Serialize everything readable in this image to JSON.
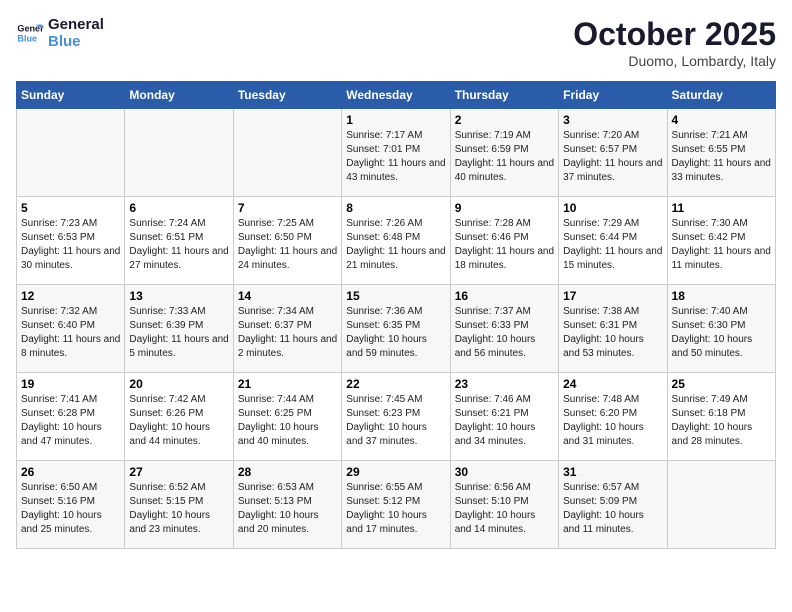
{
  "logo": {
    "line1": "General",
    "line2": "Blue"
  },
  "title": "October 2025",
  "subtitle": "Duomo, Lombardy, Italy",
  "weekdays": [
    "Sunday",
    "Monday",
    "Tuesday",
    "Wednesday",
    "Thursday",
    "Friday",
    "Saturday"
  ],
  "weeks": [
    [
      {
        "day": "",
        "sunrise": "",
        "sunset": "",
        "daylight": ""
      },
      {
        "day": "",
        "sunrise": "",
        "sunset": "",
        "daylight": ""
      },
      {
        "day": "",
        "sunrise": "",
        "sunset": "",
        "daylight": ""
      },
      {
        "day": "1",
        "sunrise": "Sunrise: 7:17 AM",
        "sunset": "Sunset: 7:01 PM",
        "daylight": "Daylight: 11 hours and 43 minutes."
      },
      {
        "day": "2",
        "sunrise": "Sunrise: 7:19 AM",
        "sunset": "Sunset: 6:59 PM",
        "daylight": "Daylight: 11 hours and 40 minutes."
      },
      {
        "day": "3",
        "sunrise": "Sunrise: 7:20 AM",
        "sunset": "Sunset: 6:57 PM",
        "daylight": "Daylight: 11 hours and 37 minutes."
      },
      {
        "day": "4",
        "sunrise": "Sunrise: 7:21 AM",
        "sunset": "Sunset: 6:55 PM",
        "daylight": "Daylight: 11 hours and 33 minutes."
      }
    ],
    [
      {
        "day": "5",
        "sunrise": "Sunrise: 7:23 AM",
        "sunset": "Sunset: 6:53 PM",
        "daylight": "Daylight: 11 hours and 30 minutes."
      },
      {
        "day": "6",
        "sunrise": "Sunrise: 7:24 AM",
        "sunset": "Sunset: 6:51 PM",
        "daylight": "Daylight: 11 hours and 27 minutes."
      },
      {
        "day": "7",
        "sunrise": "Sunrise: 7:25 AM",
        "sunset": "Sunset: 6:50 PM",
        "daylight": "Daylight: 11 hours and 24 minutes."
      },
      {
        "day": "8",
        "sunrise": "Sunrise: 7:26 AM",
        "sunset": "Sunset: 6:48 PM",
        "daylight": "Daylight: 11 hours and 21 minutes."
      },
      {
        "day": "9",
        "sunrise": "Sunrise: 7:28 AM",
        "sunset": "Sunset: 6:46 PM",
        "daylight": "Daylight: 11 hours and 18 minutes."
      },
      {
        "day": "10",
        "sunrise": "Sunrise: 7:29 AM",
        "sunset": "Sunset: 6:44 PM",
        "daylight": "Daylight: 11 hours and 15 minutes."
      },
      {
        "day": "11",
        "sunrise": "Sunrise: 7:30 AM",
        "sunset": "Sunset: 6:42 PM",
        "daylight": "Daylight: 11 hours and 11 minutes."
      }
    ],
    [
      {
        "day": "12",
        "sunrise": "Sunrise: 7:32 AM",
        "sunset": "Sunset: 6:40 PM",
        "daylight": "Daylight: 11 hours and 8 minutes."
      },
      {
        "day": "13",
        "sunrise": "Sunrise: 7:33 AM",
        "sunset": "Sunset: 6:39 PM",
        "daylight": "Daylight: 11 hours and 5 minutes."
      },
      {
        "day": "14",
        "sunrise": "Sunrise: 7:34 AM",
        "sunset": "Sunset: 6:37 PM",
        "daylight": "Daylight: 11 hours and 2 minutes."
      },
      {
        "day": "15",
        "sunrise": "Sunrise: 7:36 AM",
        "sunset": "Sunset: 6:35 PM",
        "daylight": "Daylight: 10 hours and 59 minutes."
      },
      {
        "day": "16",
        "sunrise": "Sunrise: 7:37 AM",
        "sunset": "Sunset: 6:33 PM",
        "daylight": "Daylight: 10 hours and 56 minutes."
      },
      {
        "day": "17",
        "sunrise": "Sunrise: 7:38 AM",
        "sunset": "Sunset: 6:31 PM",
        "daylight": "Daylight: 10 hours and 53 minutes."
      },
      {
        "day": "18",
        "sunrise": "Sunrise: 7:40 AM",
        "sunset": "Sunset: 6:30 PM",
        "daylight": "Daylight: 10 hours and 50 minutes."
      }
    ],
    [
      {
        "day": "19",
        "sunrise": "Sunrise: 7:41 AM",
        "sunset": "Sunset: 6:28 PM",
        "daylight": "Daylight: 10 hours and 47 minutes."
      },
      {
        "day": "20",
        "sunrise": "Sunrise: 7:42 AM",
        "sunset": "Sunset: 6:26 PM",
        "daylight": "Daylight: 10 hours and 44 minutes."
      },
      {
        "day": "21",
        "sunrise": "Sunrise: 7:44 AM",
        "sunset": "Sunset: 6:25 PM",
        "daylight": "Daylight: 10 hours and 40 minutes."
      },
      {
        "day": "22",
        "sunrise": "Sunrise: 7:45 AM",
        "sunset": "Sunset: 6:23 PM",
        "daylight": "Daylight: 10 hours and 37 minutes."
      },
      {
        "day": "23",
        "sunrise": "Sunrise: 7:46 AM",
        "sunset": "Sunset: 6:21 PM",
        "daylight": "Daylight: 10 hours and 34 minutes."
      },
      {
        "day": "24",
        "sunrise": "Sunrise: 7:48 AM",
        "sunset": "Sunset: 6:20 PM",
        "daylight": "Daylight: 10 hours and 31 minutes."
      },
      {
        "day": "25",
        "sunrise": "Sunrise: 7:49 AM",
        "sunset": "Sunset: 6:18 PM",
        "daylight": "Daylight: 10 hours and 28 minutes."
      }
    ],
    [
      {
        "day": "26",
        "sunrise": "Sunrise: 6:50 AM",
        "sunset": "Sunset: 5:16 PM",
        "daylight": "Daylight: 10 hours and 25 minutes."
      },
      {
        "day": "27",
        "sunrise": "Sunrise: 6:52 AM",
        "sunset": "Sunset: 5:15 PM",
        "daylight": "Daylight: 10 hours and 23 minutes."
      },
      {
        "day": "28",
        "sunrise": "Sunrise: 6:53 AM",
        "sunset": "Sunset: 5:13 PM",
        "daylight": "Daylight: 10 hours and 20 minutes."
      },
      {
        "day": "29",
        "sunrise": "Sunrise: 6:55 AM",
        "sunset": "Sunset: 5:12 PM",
        "daylight": "Daylight: 10 hours and 17 minutes."
      },
      {
        "day": "30",
        "sunrise": "Sunrise: 6:56 AM",
        "sunset": "Sunset: 5:10 PM",
        "daylight": "Daylight: 10 hours and 14 minutes."
      },
      {
        "day": "31",
        "sunrise": "Sunrise: 6:57 AM",
        "sunset": "Sunset: 5:09 PM",
        "daylight": "Daylight: 10 hours and 11 minutes."
      },
      {
        "day": "",
        "sunrise": "",
        "sunset": "",
        "daylight": ""
      }
    ]
  ]
}
